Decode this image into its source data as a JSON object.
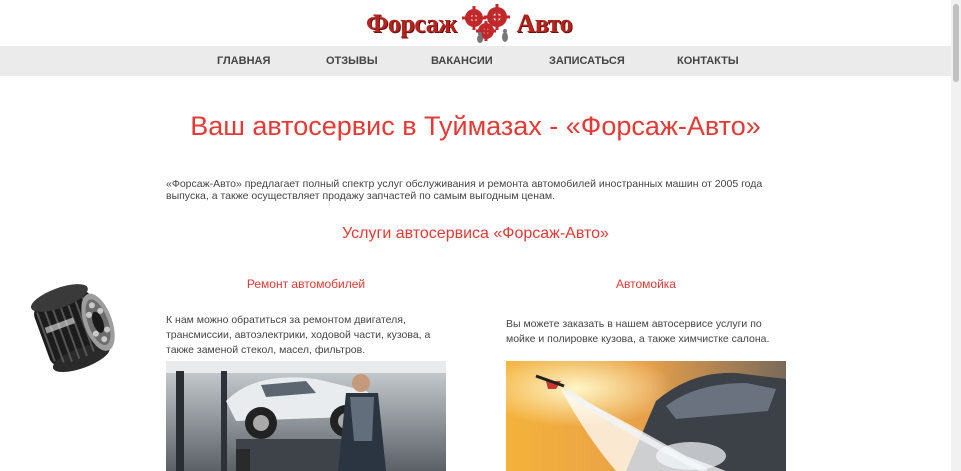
{
  "logo": {
    "left_text": "Форсаж",
    "right_text": "Авто"
  },
  "nav": {
    "items": [
      {
        "label": "ГЛАВНАЯ"
      },
      {
        "label": "ОТЗЫВЫ"
      },
      {
        "label": "ВАКАНСИИ"
      },
      {
        "label": "ЗАПИСАТЬСЯ"
      },
      {
        "label": "КОНТАКТЫ"
      }
    ]
  },
  "main": {
    "title": "Ваш автосервис в Туймазах - «Форсаж-Авто»",
    "intro": "«Форсаж-Авто» предлагает полный спектр услуг обслуживания и ремонта автомобилей иностранных машин от 2005 года выпуска, а также осуществляет продажу запчастей по самым выгодным ценам.",
    "services_title": "Услуги автосервиса «Форсаж-Авто»",
    "services": [
      {
        "title": "Ремонт автомобилей",
        "text": "К нам можно обратиться за ремонтом двигателя, трансмиссии, автоэлектрики, ходовой части, кузова, а также заменой стекол, масел, фильтров."
      },
      {
        "title": "Автомойка",
        "text": "Вы можете заказать в нашем автосервисе услуги по мойке и полировке кузова, а также химчистке салона."
      }
    ]
  },
  "colors": {
    "accent": "#e53935",
    "logo": "#b3241f",
    "nav_bg": "#ebebeb"
  }
}
